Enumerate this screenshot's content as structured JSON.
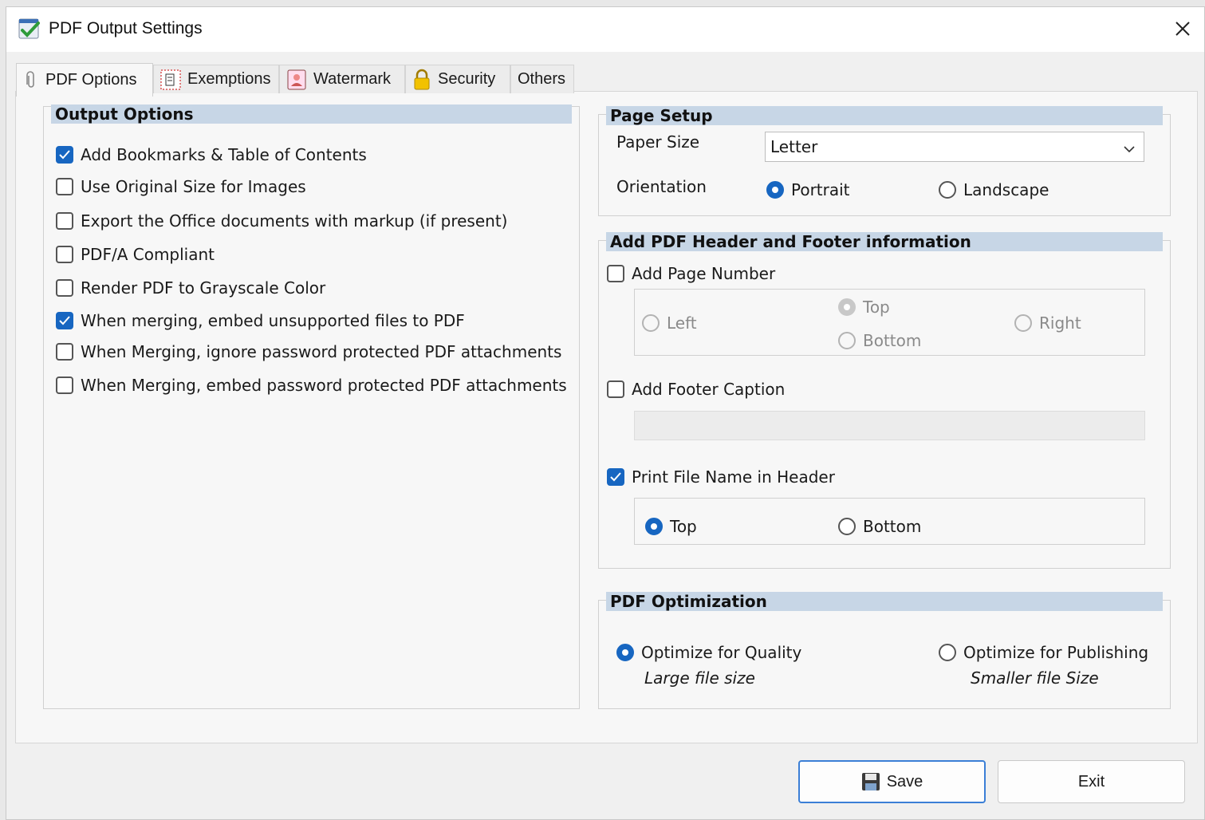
{
  "window": {
    "title": "PDF Output Settings",
    "close_icon": "close-icon"
  },
  "tabs": [
    {
      "label": "PDF Options",
      "icon": "paperclip-icon",
      "active": true
    },
    {
      "label": "Exemptions",
      "icon": "exemptions-icon",
      "active": false
    },
    {
      "label": "Watermark",
      "icon": "watermark-icon",
      "active": false
    },
    {
      "label": "Security",
      "icon": "lock-icon",
      "active": false
    },
    {
      "label": "Others",
      "icon": "",
      "active": false
    }
  ],
  "output_options": {
    "header": "Output Options",
    "items": [
      {
        "label": "Add Bookmarks & Table of Contents",
        "checked": true
      },
      {
        "label": "Use Original Size for Images",
        "checked": false
      },
      {
        "label": "Export the Office documents with markup (if present)",
        "checked": false
      },
      {
        "label": "PDF/A Compliant",
        "checked": false
      },
      {
        "label": "Render PDF to Grayscale Color",
        "checked": false
      },
      {
        "label": "When merging, embed unsupported files to PDF",
        "checked": true
      },
      {
        "label": "When Merging, ignore password protected PDF attachments",
        "checked": false
      },
      {
        "label": "When Merging, embed password protected PDF attachments",
        "checked": false
      }
    ]
  },
  "page_setup": {
    "header": "Page Setup",
    "paper_size_label": "Paper Size",
    "paper_size_value": "Letter",
    "orientation_label": "Orientation",
    "portrait": "Portrait",
    "landscape": "Landscape",
    "orientation_selected": "Portrait"
  },
  "header_footer": {
    "header": "Add PDF Header and Footer information",
    "add_page_number": "Add Page Number",
    "add_page_number_checked": false,
    "pos_left": "Left",
    "pos_top": "Top",
    "pos_bottom": "Bottom",
    "pos_right": "Right",
    "page_number_selected": "Top",
    "add_footer_caption": "Add Footer Caption",
    "add_footer_caption_checked": false,
    "footer_caption_value": "",
    "print_file_name": "Print File Name in Header",
    "print_file_name_checked": true,
    "file_name_top": "Top",
    "file_name_bottom": "Bottom",
    "file_name_selected": "Top"
  },
  "optimization": {
    "header": "PDF Optimization",
    "quality": "Optimize for Quality",
    "quality_note": "Large file size",
    "publishing": "Optimize for Publishing",
    "publishing_note": "Smaller file Size",
    "selected": "Optimize for Quality"
  },
  "buttons": {
    "save": "Save",
    "exit": "Exit",
    "save_icon": "floppy-disk-icon"
  },
  "colors": {
    "accent": "#1766c1",
    "group_header": "#c7d6e6"
  }
}
